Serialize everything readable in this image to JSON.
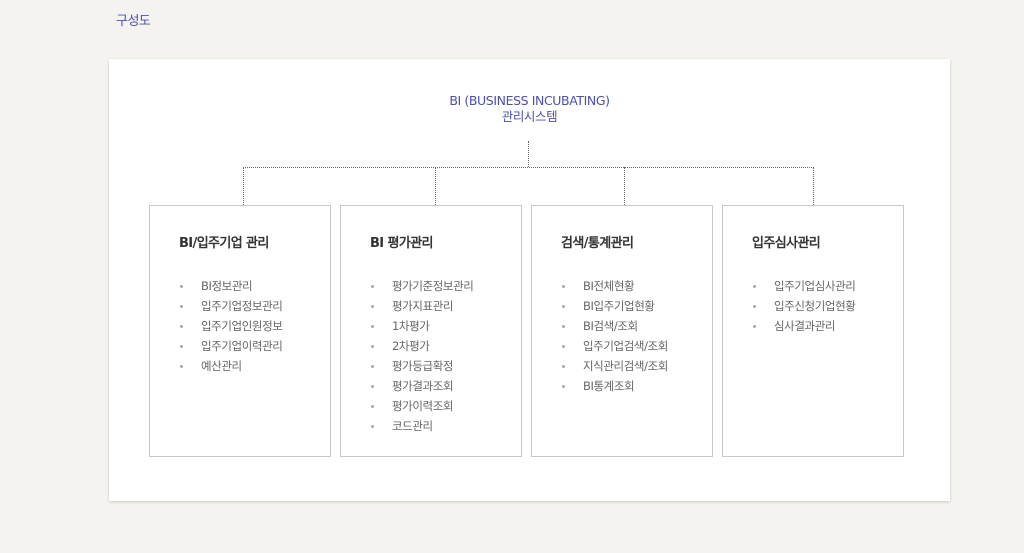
{
  "heading": "구성도",
  "root": {
    "line1": "BI (BUSINESS INCUBATING)",
    "line2": "관리시스템"
  },
  "boxes": [
    {
      "title": "BI/입주기업 관리",
      "items": [
        "BI정보관리",
        "입주기업정보관리",
        "입주기업인원정보",
        "입주기업이력관리",
        "예산관리"
      ]
    },
    {
      "title": "BI 평가관리",
      "items": [
        "평가기준정보관리",
        "평가지표관리",
        "1차평가",
        "2차평가",
        "평가등급확정",
        "평가결과조회",
        "평가이력조회",
        "코드관리"
      ]
    },
    {
      "title": "검색/통계관리",
      "items": [
        "BI전체현황",
        "BI입주기업현황",
        "BI검색/조회",
        "입주기업검색/조회",
        "지식관리검색/조회",
        "BI통계조회"
      ]
    },
    {
      "title": "입주심사관리",
      "items": [
        "입주기업심사관리",
        "입주신청기업현황",
        "심사결과관리"
      ]
    }
  ]
}
